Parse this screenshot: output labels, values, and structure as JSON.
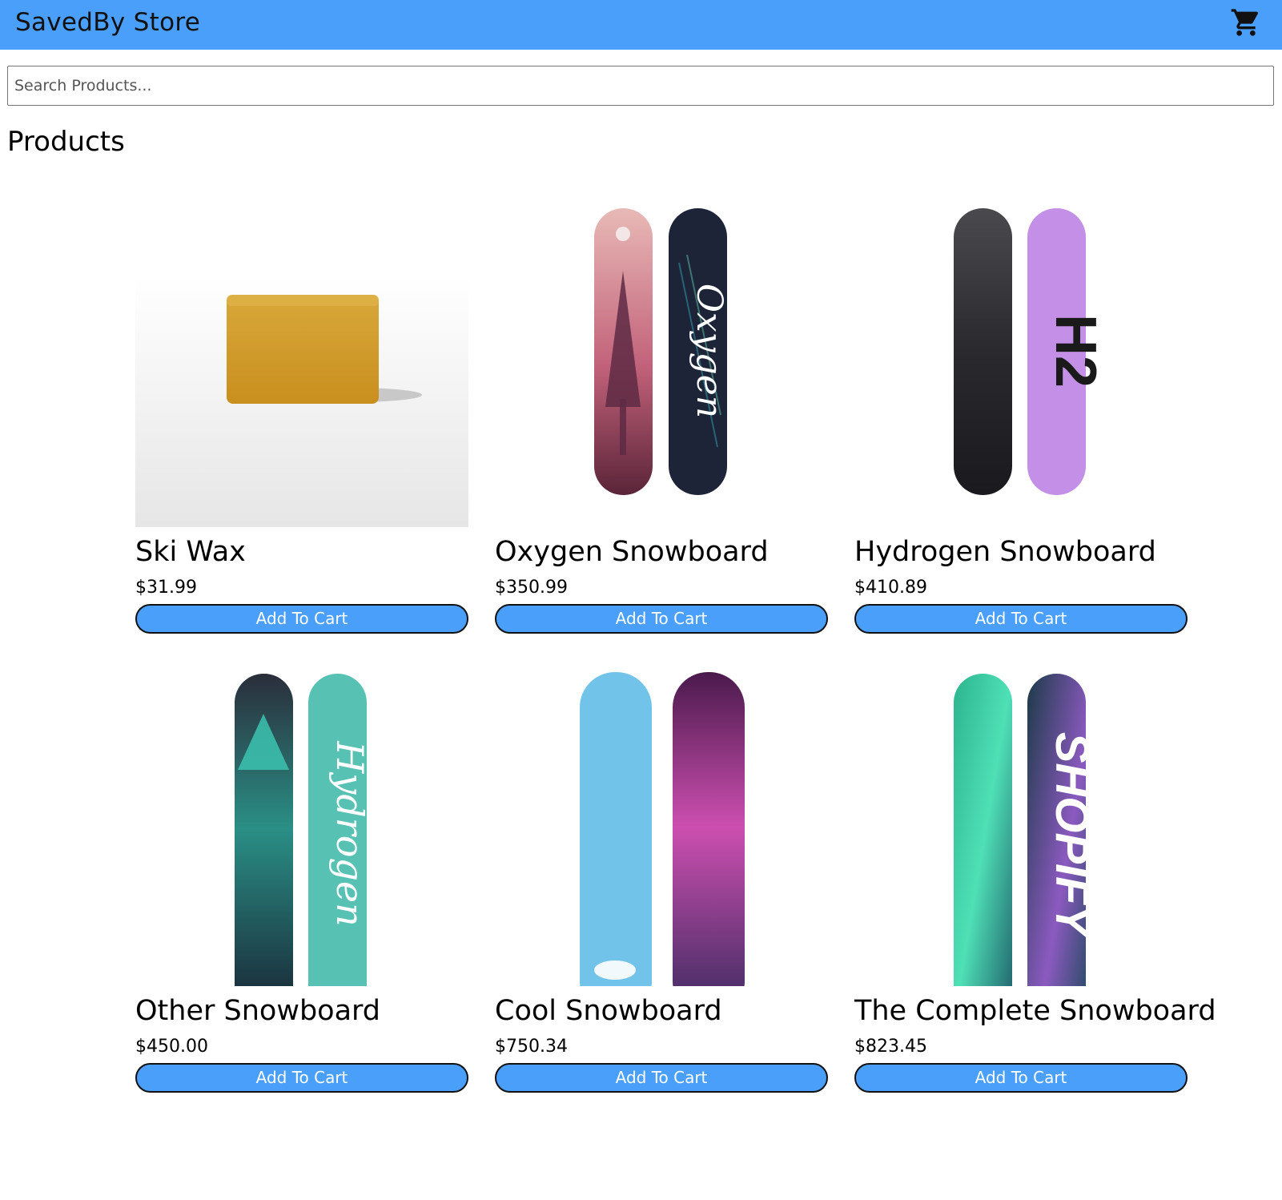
{
  "header": {
    "store_name": "SavedBy Store",
    "cart_icon": "shopping-cart-icon",
    "background": "#4a9ffb"
  },
  "search": {
    "placeholder": "Search Products...",
    "value": ""
  },
  "section_title": "Products",
  "products": [
    {
      "name": "Ski Wax",
      "price": "$31.99",
      "button": "Add To Cart",
      "image": "ski-wax-bar"
    },
    {
      "name": "Oxygen Snowboard",
      "price": "$350.99",
      "button": "Add To Cart",
      "image": "oxygen-snowboard-pair"
    },
    {
      "name": "Hydrogen Snowboard",
      "price": "$410.89",
      "button": "Add To Cart",
      "image": "hydrogen-snowboard-pair"
    },
    {
      "name": "Other Snowboard",
      "price": "$450.00",
      "button": "Add To Cart",
      "image": "other-snowboard-pair"
    },
    {
      "name": "Cool Snowboard",
      "price": "$750.34",
      "button": "Add To Cart",
      "image": "cool-snowboard-pair"
    },
    {
      "name": "The Complete Snowboard",
      "price": "$823.45",
      "button": "Add To Cart",
      "image": "complete-snowboard-pair"
    }
  ],
  "image_text": {
    "oxygen_board": "Oxygen",
    "hydrogen_board_mark": "H2",
    "hydrogen_board": "Hydrogen",
    "complete_board": "SHOPIFY"
  },
  "colors": {
    "accent": "#4a9ffb",
    "button_text": "#ffffff"
  }
}
